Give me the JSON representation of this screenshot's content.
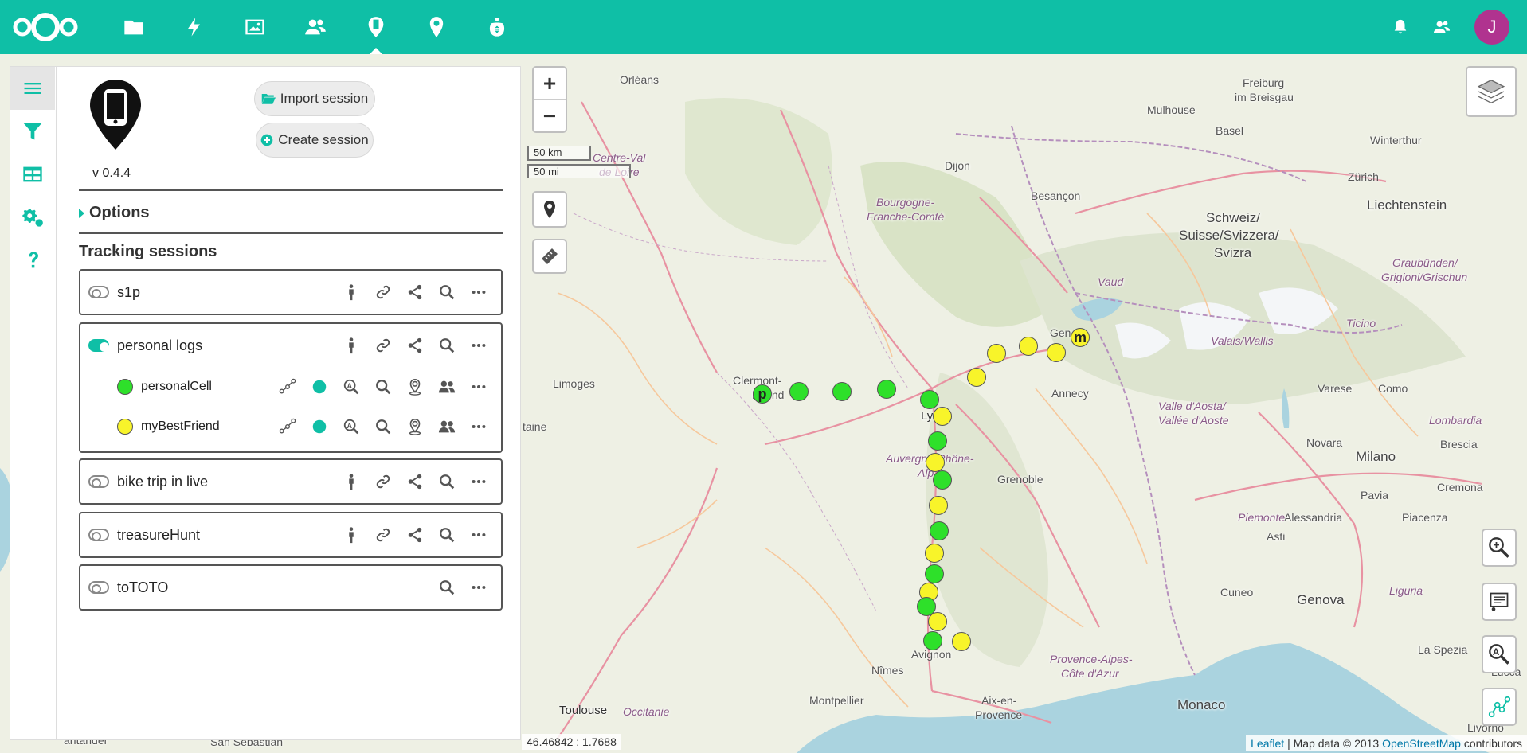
{
  "header": {
    "app_icons": [
      "files-icon",
      "activity-icon",
      "photos-icon",
      "contacts-icon",
      "phonetrack-icon",
      "maps-icon",
      "cospend-icon"
    ],
    "avatar_letter": "J"
  },
  "sidebar": {
    "version": "v 0.4.4",
    "import_label": "Import session",
    "create_label": "Create session",
    "options_label": "Options",
    "tracking_title": "Tracking sessions",
    "sessions": [
      {
        "name": "s1p",
        "enabled": false
      },
      {
        "name": "personal logs",
        "enabled": true,
        "devices": [
          {
            "name": "personalCell",
            "color": "#2ee02a"
          },
          {
            "name": "myBestFriend",
            "color": "#f8f42a"
          }
        ]
      },
      {
        "name": "bike trip in live",
        "enabled": false
      },
      {
        "name": "treasureHunt",
        "enabled": false
      },
      {
        "name": "toTOTO",
        "enabled": false
      }
    ]
  },
  "map": {
    "scale_km": "50 km",
    "scale_mi": "50 mi",
    "coordinates": "46.46842 : 1.7688",
    "attribution": {
      "leaflet": "Leaflet",
      "mid": " | Map data © 2013 ",
      "osm": "OpenStreetMap",
      "tail": " contributors"
    },
    "places": {
      "orleans": "Orléans",
      "centre": "Centre-Val",
      "de_loire": "de Loire",
      "limoges": "Limoges",
      "clermont": "Clermont-",
      "ferrand": "Fer  nd",
      "dijon": "Dijon",
      "bourgogne": "Bourgogne-",
      "franche": "Franche-Comté",
      "besancon": "Besançon",
      "mulhouse": "Mulhouse",
      "freiburg": "Freiburg",
      "breisgau": "im Breisgau",
      "basel": "Basel",
      "winterthur": "Winterthur",
      "zurich": "Zürich",
      "liechtenstein": "Liechtenstein",
      "schweiz1": "Schweiz/",
      "schweiz2": "Suisse/Svizzera/",
      "schweiz3": "Svizra",
      "graubunden1": "Graubünden/",
      "graubunden2": "Grigioni/Grischun",
      "vaud": "Vaud",
      "ticino": "Ticino",
      "valais": "Valais/Wallis",
      "geneva": "Gen",
      "annecy": "Annecy",
      "lyon": "Ly",
      "auvergne": "Auvergne-Rhône-",
      "alpes": "Alp",
      "grenoble": "Grenoble",
      "aosta1": "Valle d'Aosta/",
      "aosta2": "Vallée d'Aoste",
      "varese": "Varese",
      "como": "Como",
      "lombardia": "Lombardia",
      "novara": "Novara",
      "milano": "Milano",
      "brescia": "Brescia",
      "cremona": "Cremona",
      "pavia": "Pavia",
      "alessandria": "Alessandria",
      "piemonte": "Piemonte",
      "asti": "Asti",
      "piacenza": "Piacenza",
      "cuneo": "Cuneo",
      "genova": "Genova",
      "liguria": "Liguria",
      "laspezia": "La Spezia",
      "provence1": "Provence-Alpes-",
      "provence2": "Côte d'Azur",
      "avignon": "Avignon",
      "nimes": "Nîmes",
      "montpellier": "Montpellier",
      "aix1": "Aix-en-",
      "aix2": "Provence",
      "monaco": "Monaco",
      "toulouse": "Toulouse",
      "occitanie": "Occitanie",
      "livorno": "Livorno",
      "lucca": "Lucca",
      "aquitaine": "taine",
      "santander": "antander",
      "sansebastian": "San Sebastián"
    },
    "markers": {
      "p_label": "p",
      "m_label": "m"
    }
  }
}
